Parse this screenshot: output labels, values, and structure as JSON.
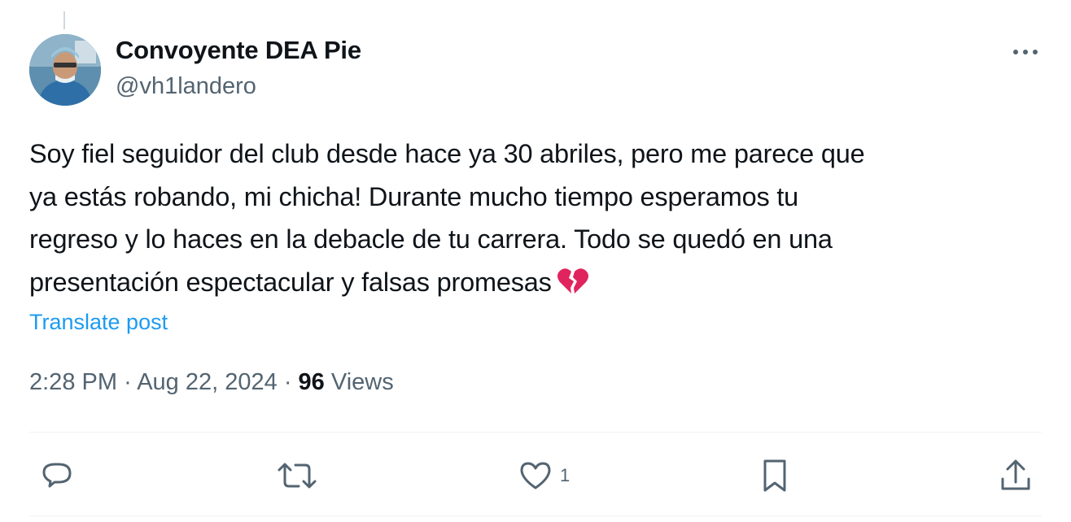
{
  "post": {
    "author_name": "Convoyente DEA Pie",
    "author_handle": "@vh1landero",
    "text_lines": [
      "Soy fiel seguidor del club desde hace ya 30 abriles, pero me parece que",
      "ya estás robando, mi chicha! Durante mucho tiempo esperamos tu",
      "regreso y lo haces en la debacle de tu carrera. Todo se quedó en una",
      "presentación espectacular y falsas promesas"
    ],
    "emoji": "broken-heart-icon",
    "translate_label": "Translate post",
    "time": "2:28 PM",
    "separator": "·",
    "date": "Aug 22, 2024",
    "views_count": "96",
    "views_label": "Views",
    "likes_count": "1"
  },
  "actions": {
    "reply_icon": "reply-icon",
    "repost_icon": "repost-icon",
    "like_icon": "heart-icon",
    "bookmark_icon": "bookmark-icon",
    "share_icon": "share-icon"
  },
  "colors": {
    "text": "#0f1419",
    "secondary": "#536471",
    "link": "#1d9bf0",
    "divider": "#eff3f4",
    "broken_heart": "#e0245e"
  }
}
